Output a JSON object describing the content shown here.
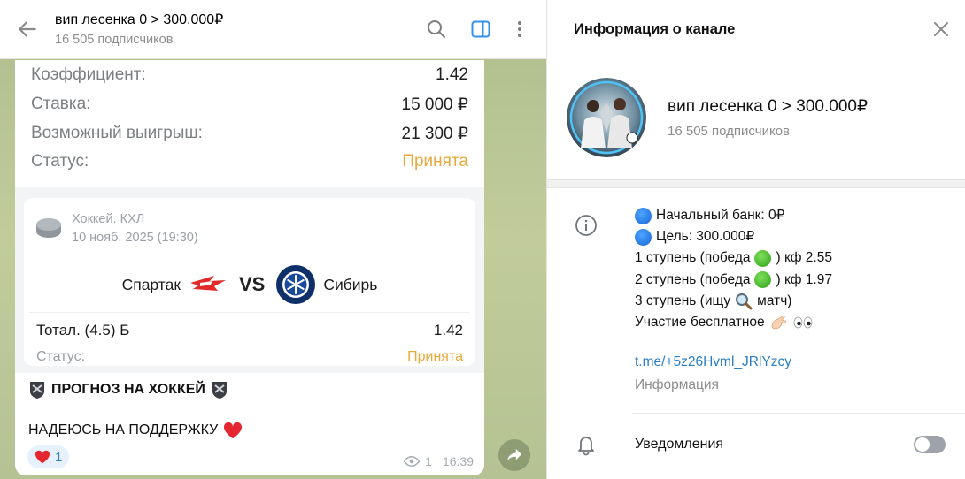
{
  "chat": {
    "title": "вип лесенка 0 > 300.000₽",
    "subscribers": "16 505 подписчиков"
  },
  "bet": {
    "rows": [
      {
        "key": "Коэффициент:",
        "value": "1.42"
      },
      {
        "key": "Ставка:",
        "value": "15 000 ₽"
      },
      {
        "key": "Возможный выигрыш:",
        "value": "21 300 ₽"
      },
      {
        "key": "Статус:",
        "value": "Принята"
      }
    ]
  },
  "card": {
    "league": "Хоккей. КХЛ",
    "date": "10 нояб. 2025 (19:30)",
    "team1": "Спартак",
    "vs": "VS",
    "team2": "Сибирь",
    "market": "Тотал. (4.5) Б",
    "odds": "1.42",
    "status_key": "Статус:",
    "status_value": "Принята"
  },
  "message": {
    "line1": "ПРОГНОЗ НА ХОККЕЙ",
    "line2": "НАДЕЮСЬ НА ПОДДЕРЖКУ",
    "reaction_count": "1",
    "views": "1",
    "time": "16:39"
  },
  "info": {
    "panel_title": "Информация о канале",
    "channel_name": "вип лесенка 0 > 300.000₽",
    "subscribers": "16 505 подписчиков",
    "desc": {
      "l1": "Начальный банк: 0₽",
      "l2": "Цель: 300.000₽",
      "l3a": "1 ступень (победа",
      "l3b": ") кф 2.55",
      "l4a": "2 ступень (победа",
      "l4b": ") кф 1.97",
      "l5a": "3 ступень (ищу",
      "l5b": "матч)",
      "l6": "Участие бесплатное"
    },
    "link": "t.me/+5z26Hvml_JRlYzcy",
    "link_caption": "Информация",
    "notifications_label": "Уведомления"
  },
  "colors": {
    "accepted": "#e9a93a",
    "link": "#2a7ec2",
    "accent": "#3390ec"
  },
  "icons": [
    "back-arrow-icon",
    "search-icon",
    "sidebar-toggle-icon",
    "more-vertical-icon",
    "close-icon",
    "info-icon",
    "bell-icon",
    "share-icon",
    "eye-icon",
    "heart-icon",
    "hockey-puck-icon",
    "magnifier-icon"
  ]
}
